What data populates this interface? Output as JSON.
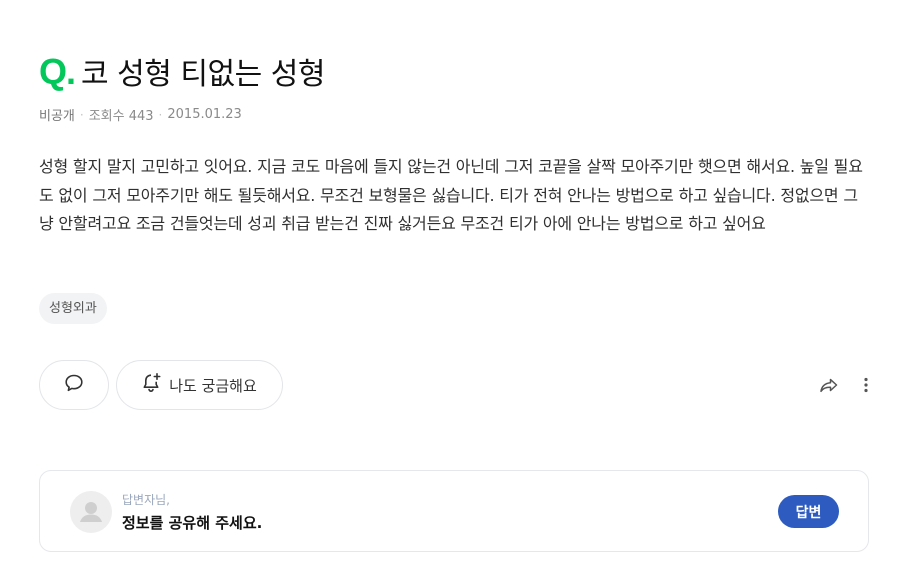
{
  "question": {
    "mark": "Q.",
    "title": "코 성형 티없는 성형"
  },
  "meta": {
    "visibility": "비공개",
    "views_label": "조회수 443",
    "date": "2015.01.23"
  },
  "body": "성형 할지 말지 고민하고 잇어요. 지금 코도 마음에 들지 않는건 아닌데 그저 코끝을 살짝 모아주기만 햇으면 해서요. 높일 필요도 없이 그저 모아주기만 해도 될듯해서요. 무조건 보형물은 싫습니다. 티가 전혀 안나는 방법으로 하고 싶습니다. 정없으면 그냥 안할려고요 조금 건들엇는데 성괴 취급 받는건 진짜 싫거든요 무조건 티가 아에 안나는 방법으로 하고 싶어요",
  "tags": [
    "성형외과"
  ],
  "actions": {
    "curious_label": "나도 궁금해요"
  },
  "answer_prompt": {
    "greeting": "답변자님,",
    "message": "정보를 공유해 주세요.",
    "button_label": "답변"
  },
  "colors": {
    "q_mark": "#03c75a",
    "answer_button": "#2d5bbf"
  },
  "icons": [
    "comment-icon",
    "bell-plus-icon",
    "share-icon",
    "more-icon",
    "user-avatar-icon"
  ]
}
